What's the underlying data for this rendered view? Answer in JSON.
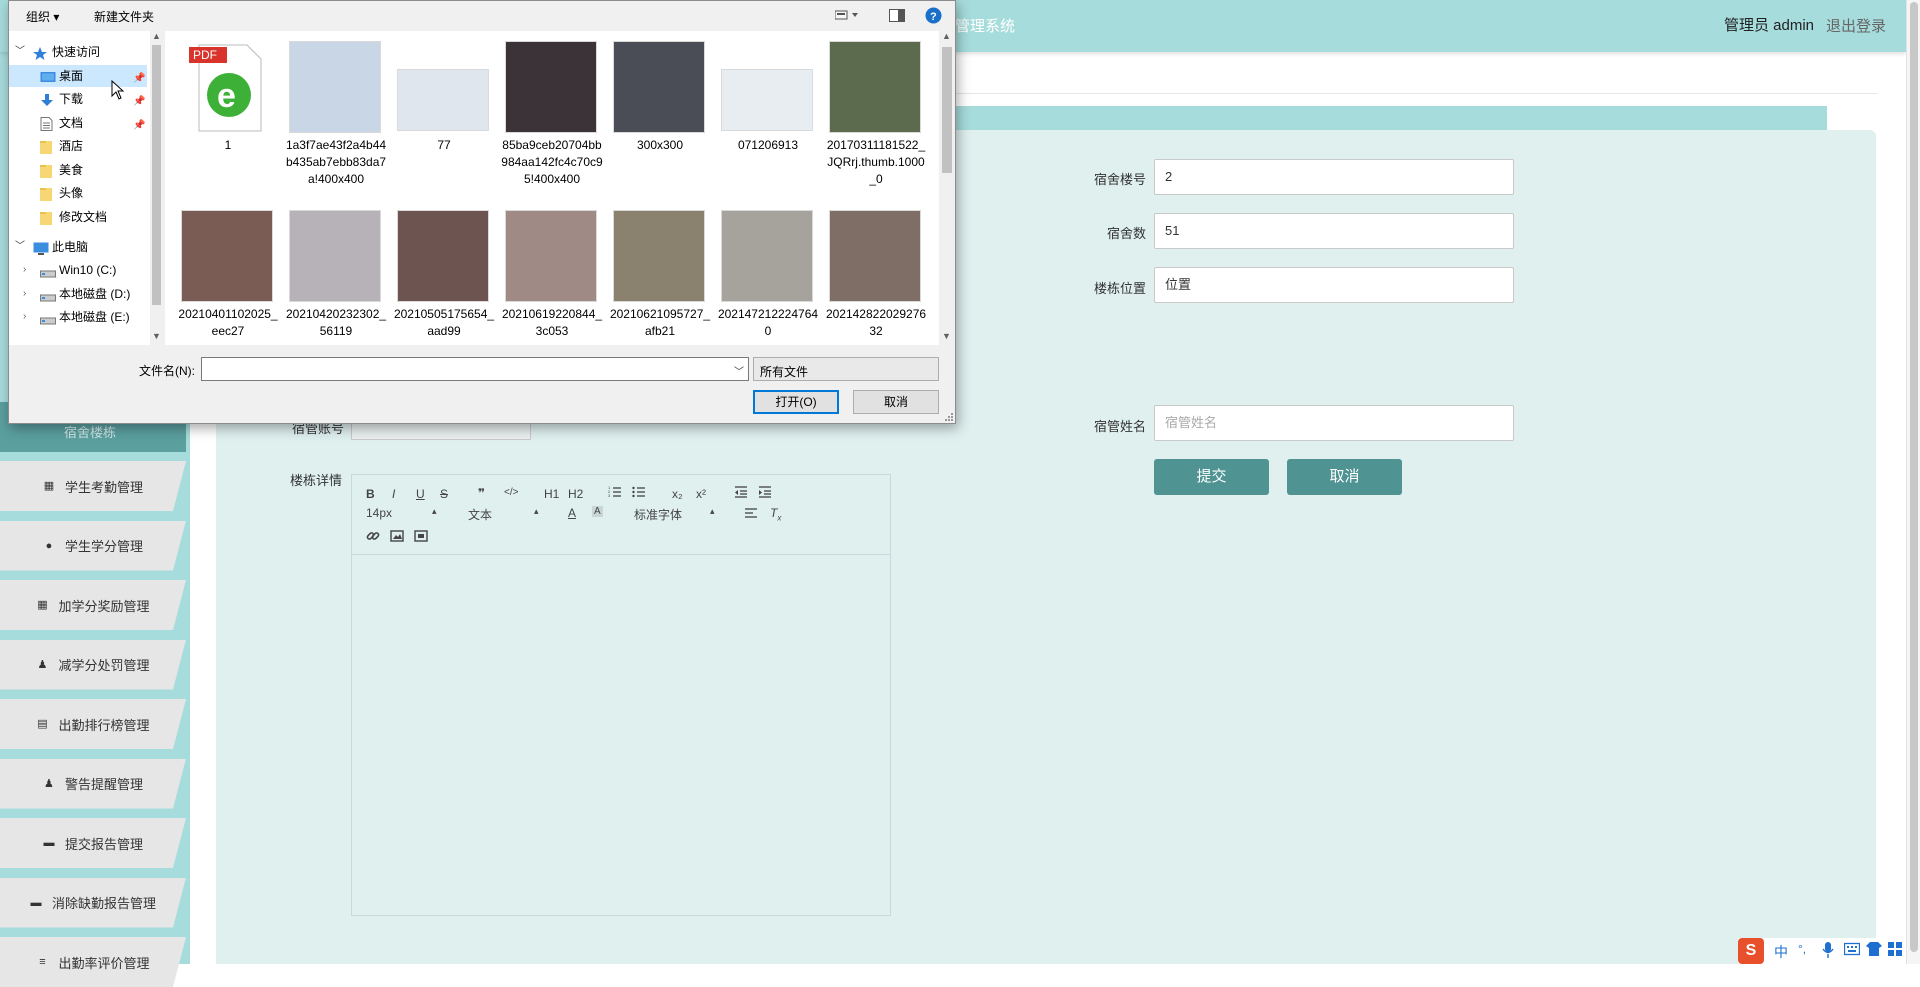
{
  "app": {
    "title_fragment": "管理系统",
    "user_label": "管理员 admin",
    "logout_label": "退出登录",
    "colors": {
      "accent": "#a7dcdc",
      "button": "#4f9393",
      "content_bg": "#dff0ef"
    }
  },
  "sidebar": {
    "active_item": "宿舍楼栋",
    "items": [
      {
        "label": "学生考勤管理",
        "icon": "grid-icon"
      },
      {
        "label": "学生学分管理",
        "icon": "bulb-icon"
      },
      {
        "label": "加学分奖励管理",
        "icon": "grid-icon"
      },
      {
        "label": "减学分处罚管理",
        "icon": "user-icon"
      },
      {
        "label": "出勤排行榜管理",
        "icon": "clipboard-icon"
      },
      {
        "label": "警告提醒管理",
        "icon": "user-icon"
      },
      {
        "label": "提交报告管理",
        "icon": "flag-icon"
      },
      {
        "label": "消除缺勤报告管理",
        "icon": "flag-icon"
      },
      {
        "label": "出勤率评价管理",
        "icon": "sliders-icon"
      }
    ]
  },
  "form": {
    "fields": [
      {
        "label": "宿舍楼号",
        "value": "2"
      },
      {
        "label": "宿舍数",
        "value": "51"
      },
      {
        "label": "楼栋位置",
        "value": "位置"
      }
    ],
    "manager_label": "宿管姓名",
    "manager_placeholder": "宿管姓名",
    "partial_label": "宿管账号",
    "detail_label": "楼栋详情",
    "submit_label": "提交",
    "cancel_label": "取消"
  },
  "editor": {
    "font_size": "14px",
    "text_type": "文本",
    "font_family": "标准字体",
    "tools_row1": [
      "B",
      "I",
      "U",
      "S",
      "❞",
      "</>",
      "H1",
      "H2",
      "ol",
      "ul",
      "x₂",
      "x²",
      "outdent",
      "indent"
    ],
    "tools_row3": [
      "link",
      "image",
      "video"
    ]
  },
  "dialog": {
    "toolbar": {
      "organize": "组织 ▾",
      "new_folder": "新建文件夹"
    },
    "nav": [
      {
        "label": "快速访问",
        "icon": "star-icon",
        "level": 0,
        "expanded": true
      },
      {
        "label": "桌面",
        "icon": "desktop-icon",
        "level": 1,
        "pinned": true,
        "selected": true
      },
      {
        "label": "下载",
        "icon": "download-icon",
        "level": 1,
        "pinned": true
      },
      {
        "label": "文档",
        "icon": "document-icon",
        "level": 1,
        "pinned": true
      },
      {
        "label": "酒店",
        "icon": "folder-icon",
        "level": 1
      },
      {
        "label": "美食",
        "icon": "folder-icon",
        "level": 1
      },
      {
        "label": "头像",
        "icon": "folder-icon",
        "level": 1
      },
      {
        "label": "修改文档",
        "icon": "folder-icon",
        "level": 1
      },
      {
        "label": "此电脑",
        "icon": "computer-icon",
        "level": 0,
        "expanded": true
      },
      {
        "label": "Win10 (C:)",
        "icon": "drive-icon",
        "level": 1
      },
      {
        "label": "本地磁盘 (D:)",
        "icon": "drive-icon",
        "level": 1
      },
      {
        "label": "本地磁盘 (E:)",
        "icon": "drive-icon",
        "level": 1
      }
    ],
    "files": [
      {
        "name": "1",
        "kind": "pdf",
        "color": "#2ea043"
      },
      {
        "name": "1a3f7ae43f2a4b44b435ab7ebb83da7a!400x400",
        "kind": "photo",
        "color": "#c9d6e6"
      },
      {
        "name": "77",
        "kind": "photo-wide",
        "color": "#dfe6ee"
      },
      {
        "name": "85ba9ceb20704bb984aa142fc4c70c95!400x400",
        "kind": "photo",
        "color": "#3b3338"
      },
      {
        "name": "300x300",
        "kind": "photo",
        "color": "#4a4d55"
      },
      {
        "name": "071206913",
        "kind": "photo-wide",
        "color": "#e8edf2"
      },
      {
        "name": "20170311181522_JQRrj.thumb.1000_0",
        "kind": "photo",
        "color": "#5c6b4e"
      },
      {
        "name": "20210401102025_eec27",
        "kind": "photo",
        "color": "#7a5c55"
      },
      {
        "name": "20210420232302_56119",
        "kind": "photo",
        "color": "#b7b2b8"
      },
      {
        "name": "20210505175654_aad99",
        "kind": "photo",
        "color": "#6e5450"
      },
      {
        "name": "20210619220844_3c053",
        "kind": "photo",
        "color": "#a08a86"
      },
      {
        "name": "20210621095727_afb21",
        "kind": "photo",
        "color": "#8a826f"
      },
      {
        "name": "2021472122247640",
        "kind": "photo",
        "color": "#a6a29c"
      },
      {
        "name": "20214282202927632",
        "kind": "photo",
        "color": "#7e6e66"
      }
    ],
    "filename_label": "文件名(N):",
    "filename_value": "",
    "filetype_value": "所有文件",
    "open_label": "打开(O)",
    "cancel_label": "取消"
  },
  "ime": {
    "logo": "S",
    "lang": "中",
    "punct": "°,",
    "items": [
      "mic",
      "keyboard",
      "shirt",
      "grid"
    ]
  }
}
